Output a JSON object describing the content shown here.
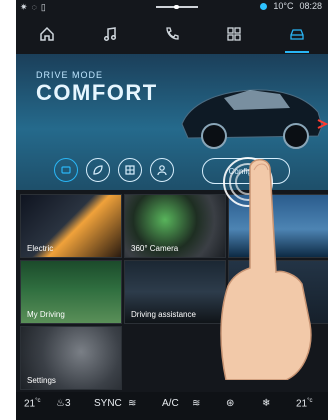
{
  "status": {
    "left_icons": [
      "bluetooth-icon",
      "wifi-icon",
      "phone-icon"
    ],
    "temp": "10°C",
    "time": "08:28"
  },
  "nav": [
    {
      "name": "home-icon"
    },
    {
      "name": "music-icon"
    },
    {
      "name": "phone-icon"
    },
    {
      "name": "apps-icon"
    },
    {
      "name": "car-icon",
      "active": true
    }
  ],
  "hero": {
    "sub": "DRIVE MODE",
    "title": "COMFORT",
    "configure": "Configure"
  },
  "tiles": [
    {
      "label": "Electric"
    },
    {
      "label": "360° Camera"
    },
    {
      "label": ""
    },
    {
      "label": "My Driving"
    },
    {
      "label": "Driving assistance"
    },
    {
      "label": ""
    },
    {
      "label": "Settings"
    }
  ],
  "bottom": {
    "left_temp": "21",
    "left_unit": "°c",
    "seat_level": "3",
    "sync": "SYNC",
    "ac": "A/C",
    "right_temp": "21",
    "right_unit": "°c"
  },
  "colors": {
    "accent": "#29b6f6",
    "hero": "#256a8c",
    "background": "#14171c"
  }
}
